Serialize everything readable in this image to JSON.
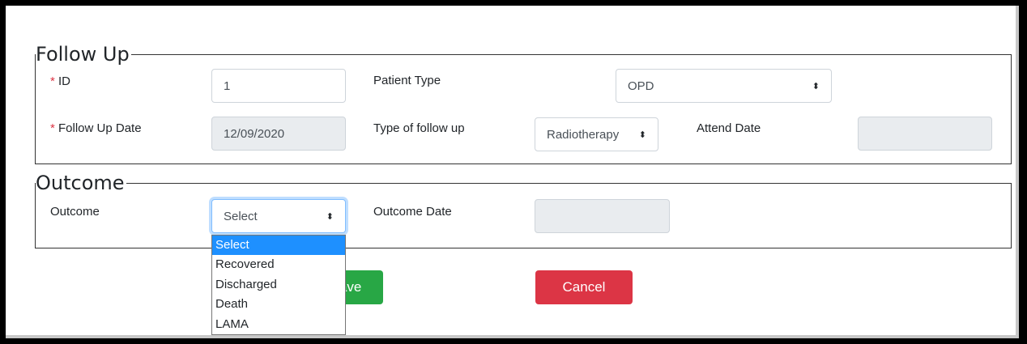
{
  "follow_up": {
    "legend": "Follow Up",
    "required_mark": "*",
    "id_label": "ID",
    "id_value": "1",
    "patient_type_label": "Patient Type",
    "patient_type_value": "OPD",
    "follow_up_date_label": "Follow Up Date",
    "follow_up_date_value": "12/09/2020",
    "type_of_follow_up_label": "Type of follow up",
    "type_of_follow_up_value": "Radiotherapy",
    "attend_date_label": "Attend Date",
    "attend_date_value": ""
  },
  "outcome": {
    "legend": "Outcome",
    "outcome_label": "Outcome",
    "outcome_value": "Select",
    "outcome_date_label": "Outcome Date",
    "outcome_date_value": "",
    "options": [
      "Select",
      "Recovered",
      "Discharged",
      "Death",
      "LAMA"
    ],
    "selected_index": 0
  },
  "actions": {
    "save_label": "Save",
    "cancel_label": "Cancel"
  },
  "colors": {
    "save": "#28a745",
    "cancel": "#dc3545",
    "required": "#dc3545",
    "dropdown_highlight": "#1e90ff"
  },
  "icons": {
    "select_caret": "updown-caret-icon"
  }
}
